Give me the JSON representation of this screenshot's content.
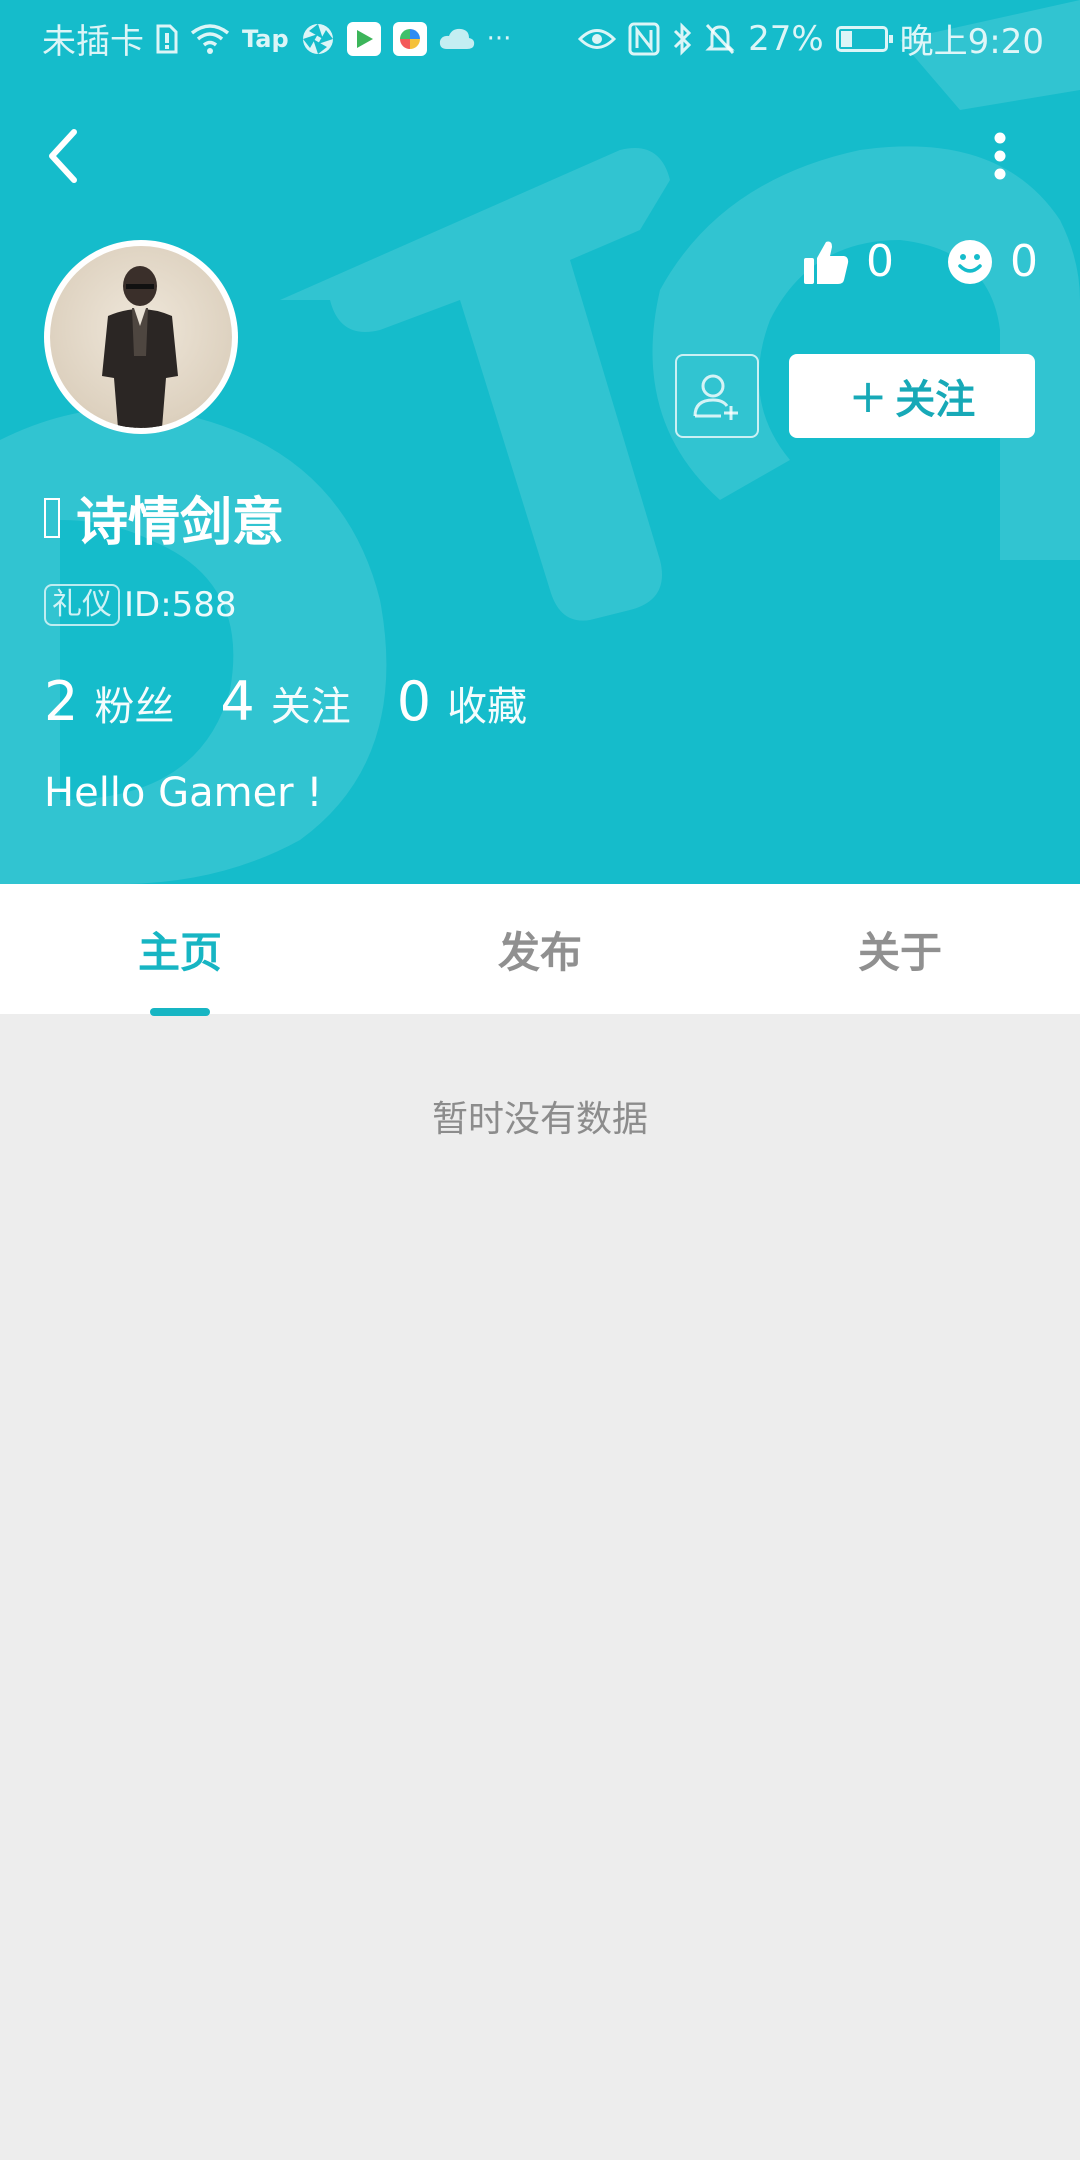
{
  "status_bar": {
    "carrier": "未插卡",
    "tap_label": "Tap",
    "more": "···",
    "battery": "27%",
    "time": "晚上9:20"
  },
  "profile": {
    "name": "诗情剑意",
    "badge": "礼仪",
    "id_text": "ID:588",
    "likes": "0",
    "smiles": "0",
    "follow_label": "关注",
    "bio": "Hello Gamer !"
  },
  "counts": [
    {
      "number": "2",
      "label": "粉丝"
    },
    {
      "number": "4",
      "label": "关注"
    },
    {
      "number": "0",
      "label": "收藏"
    }
  ],
  "tabs": [
    {
      "label": "主页"
    },
    {
      "label": "发布"
    },
    {
      "label": "关于"
    }
  ],
  "empty_text": "暂时没有数据",
  "colors": {
    "header": "#15bccb",
    "accent": "#17b5c3",
    "background": "#ededed"
  }
}
